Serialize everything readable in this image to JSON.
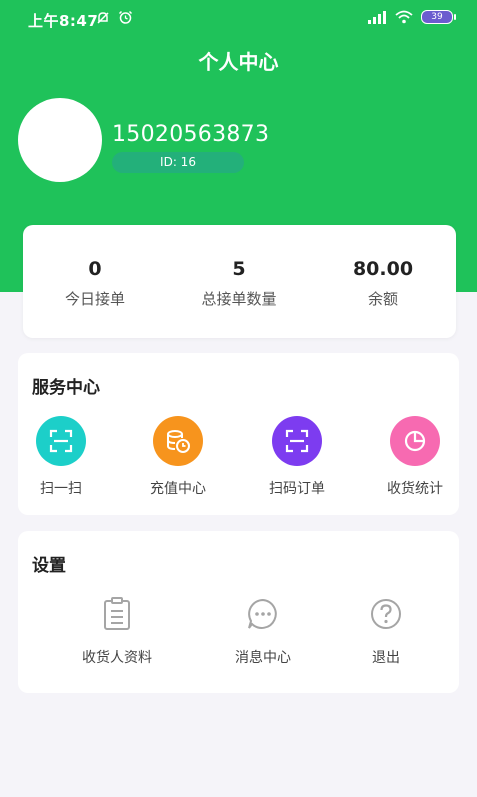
{
  "status_bar": {
    "time": "上午8:47",
    "battery": "39",
    "icons": [
      "bell-off-icon",
      "alarm-icon",
      "signal-icon",
      "wifi-icon",
      "battery-icon"
    ]
  },
  "header": {
    "title": "个人中心",
    "background": "#1fc25a"
  },
  "profile": {
    "phone": "15020563873",
    "id_text": "ID: 16"
  },
  "stats": [
    {
      "value": "0",
      "label": "今日接单"
    },
    {
      "value": "5",
      "label": "总接单数量"
    },
    {
      "value": "80.00",
      "label": "余额"
    }
  ],
  "service_center": {
    "title": "服务中心",
    "items": [
      {
        "label": "扫一扫",
        "icon": "scan-icon",
        "color": "#1ccfc9"
      },
      {
        "label": "充值中心",
        "icon": "recharge-icon",
        "color": "#f7941d"
      },
      {
        "label": "扫码订单",
        "icon": "scan-order-icon",
        "color": "#7d3cf0"
      },
      {
        "label": "收货统计",
        "icon": "pie-chart-icon",
        "color": "#f76ab1"
      }
    ]
  },
  "settings": {
    "title": "设置",
    "items": [
      {
        "label": "收货人资料",
        "icon": "clipboard-icon"
      },
      {
        "label": "消息中心",
        "icon": "message-icon"
      },
      {
        "label": "退出",
        "icon": "help-icon"
      }
    ]
  }
}
